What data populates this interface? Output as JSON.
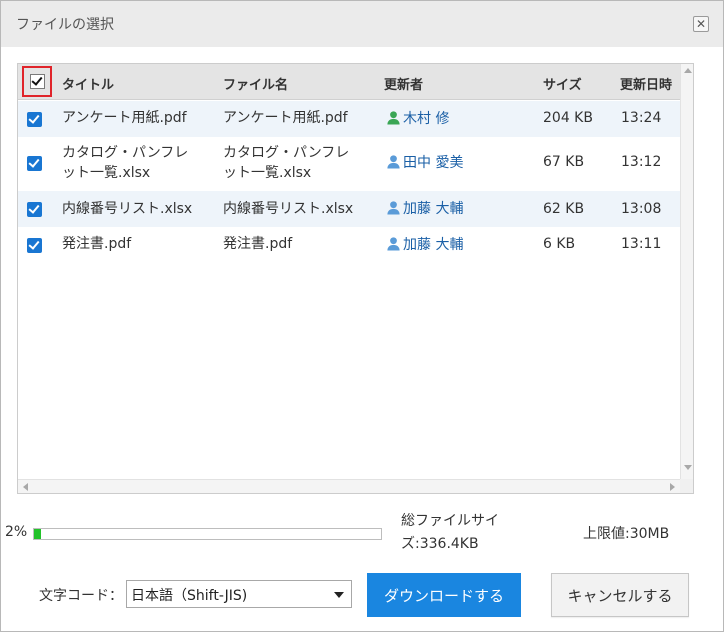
{
  "dialog": {
    "title": "ファイルの選択",
    "close_icon": "close-icon"
  },
  "table": {
    "headers": {
      "title": "タイトル",
      "filename": "ファイル名",
      "updater": "更新者",
      "size": "サイズ",
      "updated": "更新日時"
    },
    "select_all_checked": true,
    "rows": [
      {
        "checked": true,
        "title_lines": [
          "アンケート用紙.pdf"
        ],
        "filename_lines": [
          "アンケート用紙.pdf"
        ],
        "updater": "木村 修",
        "updater_icon": "user-icon-green",
        "size": "204 KB",
        "time": "13:24"
      },
      {
        "checked": true,
        "title_lines": [
          "カタログ・パンフレ",
          "ット一覧.xlsx"
        ],
        "filename_lines": [
          "カタログ・パンフレ",
          "ット一覧.xlsx"
        ],
        "updater": "田中 愛美",
        "updater_icon": "user-icon-blue",
        "size": "67 KB",
        "time": "13:12"
      },
      {
        "checked": true,
        "title_lines": [
          "内線番号リスト.xlsx"
        ],
        "filename_lines": [
          "内線番号リスト.xlsx"
        ],
        "updater": "加藤 大輔",
        "updater_icon": "user-icon-blue",
        "size": "62 KB",
        "time": "13:08"
      },
      {
        "checked": true,
        "title_lines": [
          "発注書.pdf"
        ],
        "filename_lines": [
          "発注書.pdf"
        ],
        "updater": "加藤 大輔",
        "updater_icon": "user-icon-blue",
        "size": "6 KB",
        "time": "13:11"
      }
    ]
  },
  "summary": {
    "progress_percent_label": "2%",
    "progress_fraction": 0.02,
    "total_size_line1": "総ファイルサイ",
    "total_size_line2": "ズ:336.4KB",
    "limit": "上限値:30MB"
  },
  "footer": {
    "encoding_label": "文字コード：",
    "encoding_value": "日本語（Shift-JIS)",
    "download_button": "ダウンロードする",
    "cancel_button": "キャンセルする"
  },
  "colors": {
    "accent": "#1a86e0",
    "checkbox": "#1976d2",
    "progress": "#22c22a",
    "user_green": "#3aa655",
    "user_blue": "#5a9bd8",
    "highlight": "#e0242a"
  }
}
